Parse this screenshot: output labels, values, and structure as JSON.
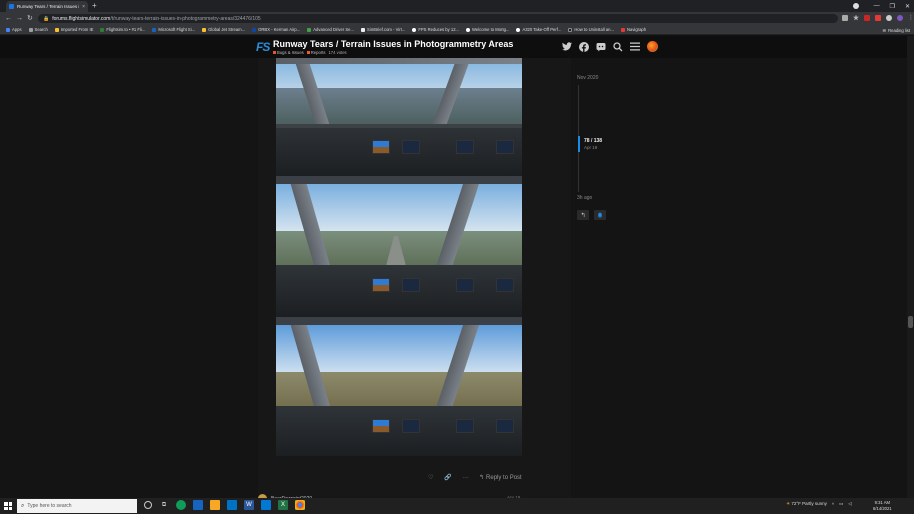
{
  "browser": {
    "tab_title": "Runway Tears / Terrain Issues in P...",
    "tab_close": "×",
    "new_tab": "+",
    "url_host": "forums.flightsimulator.com",
    "url_path": "/t/runway-tears-terrain-issues-in-photogrammetry-areas/324476/105",
    "window_controls": [
      "—",
      "❐",
      "✕"
    ],
    "bookmarks": [
      "Apps",
      "Search",
      "Imported From IE",
      "Flightsim.to • #1 Fli...",
      "Microsoft Flight Si...",
      "Global Jet Stream...",
      "ORBX - Kerman Airp...",
      "Advanced Driver Se...",
      "SimBrief.com - Virt...",
      "FPS Reduces by 12...",
      "Welcome to Mortg...",
      "A320 Take-Off Perf...",
      "How to Uninstall an...",
      "Navigraph"
    ],
    "reading_list": "Reading list"
  },
  "header": {
    "logo": "FS",
    "title": "Runway Tears / Terrain Issues in Photogrammetry Areas",
    "category1": "Bugs & Issues",
    "category2": "Reports",
    "votes": "174 votes"
  },
  "post": {
    "reply_label": "Reply to Post",
    "next_author": "BearPawprint2020",
    "next_date": "Apr 19"
  },
  "timeline": {
    "start": "Nov 2020",
    "position": "78 / 138",
    "current_date": "Apr 19",
    "end": "3h ago"
  },
  "taskbar": {
    "search_placeholder": "Type here to search",
    "weather": "72°F  Partly sunny",
    "time": "9:31 AM",
    "date": "6/14/2021"
  },
  "colors": {
    "accent": "#1e88e5",
    "category1": "#e45735",
    "category2": "#f1592a"
  }
}
